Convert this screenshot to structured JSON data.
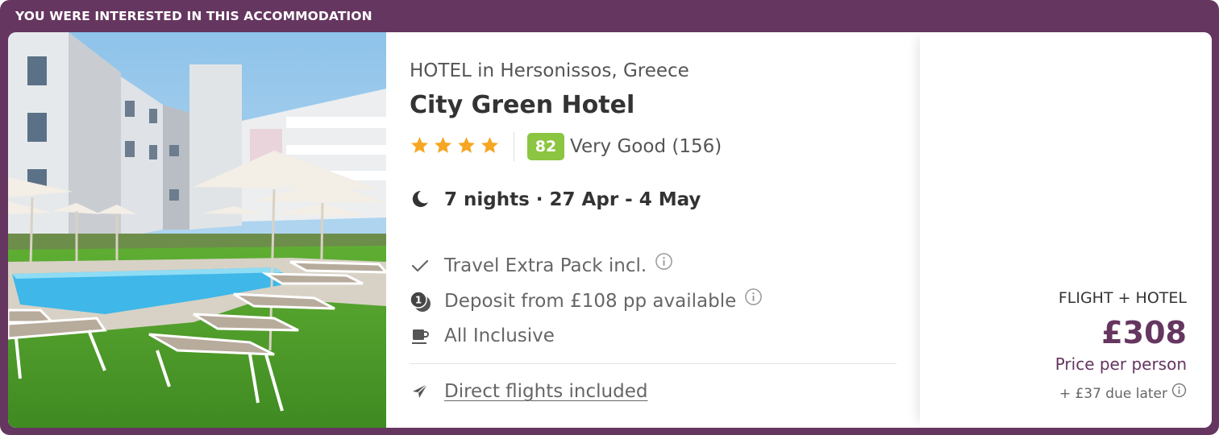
{
  "banner": {
    "label": "YOU WERE INTERESTED IN THIS ACCOMMODATION"
  },
  "hotel": {
    "location": "HOTEL in Hersonissos, Greece",
    "name": "City Green Hotel",
    "star_count": 4,
    "score": "82",
    "score_label": "Very Good (156)"
  },
  "stay": {
    "dates": "7 nights · 27 Apr - 4 May",
    "icon": "moon-icon"
  },
  "features": [
    {
      "icon": "check-icon",
      "label": "Travel Extra Pack incl.",
      "has_info": true
    },
    {
      "icon": "deposit-icon",
      "label": "Deposit from £108 pp available",
      "has_info": true
    },
    {
      "icon": "cup-icon",
      "label": "All Inclusive",
      "has_info": false
    }
  ],
  "flights": {
    "icon": "plane-icon",
    "label": "Direct flights included"
  },
  "price": {
    "package_label": "FLIGHT + HOTEL",
    "amount": "£308",
    "per_person": "Price per person",
    "due_later": "+ £37 due later"
  },
  "colors": {
    "brand": "#65365f",
    "score_badge": "#8cc541",
    "star": "#f6a623",
    "pool": "#3fb7e8",
    "grass": "#56a32c"
  }
}
